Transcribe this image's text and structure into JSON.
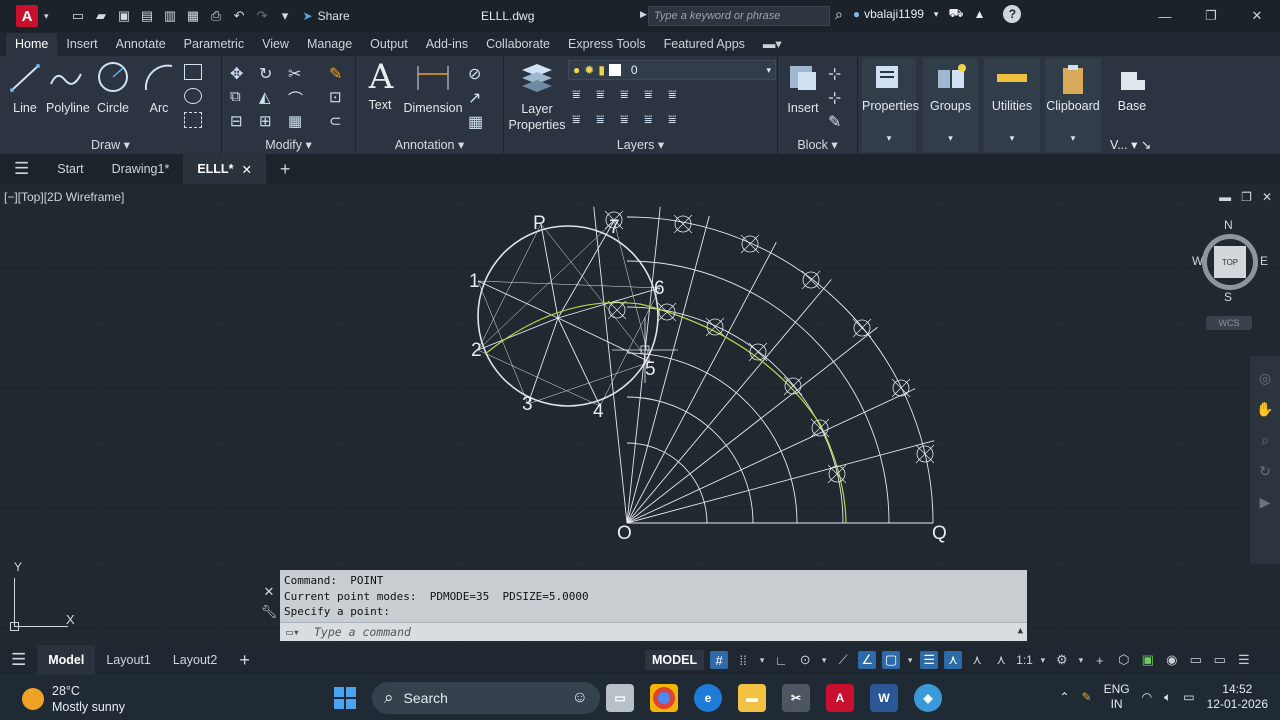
{
  "titlebar": {
    "share_label": "Share",
    "doc_title": "ELLL.dwg",
    "search_placeholder": "Type a keyword or phrase",
    "username": "vbalaji1199"
  },
  "ribbon_tabs": [
    "Home",
    "Insert",
    "Annotate",
    "Parametric",
    "View",
    "Manage",
    "Output",
    "Add-ins",
    "Collaborate",
    "Express Tools",
    "Featured Apps"
  ],
  "ribbon": {
    "draw": {
      "title": "Draw",
      "line": "Line",
      "polyline": "Polyline",
      "circle": "Circle",
      "arc": "Arc"
    },
    "modify": {
      "title": "Modify"
    },
    "annotation": {
      "title": "Annotation",
      "text": "Text",
      "dimension": "Dimension"
    },
    "layers": {
      "title": "Layers",
      "layer_properties_1": "Layer",
      "layer_properties_2": "Properties",
      "current_layer": "0"
    },
    "block": {
      "title": "Block",
      "insert": "Insert"
    },
    "properties": "Properties",
    "groups": "Groups",
    "utilities": "Utilities",
    "clipboard": "Clipboard",
    "base": "Base",
    "view_short": "V..."
  },
  "file_tabs": {
    "start": "Start",
    "drawing1": "Drawing1*",
    "active": "ELLL*"
  },
  "viewport": {
    "label": "[−][Top][2D Wireframe]",
    "viewcube": {
      "north": "N",
      "south": "S",
      "east": "E",
      "west": "W",
      "top": "TOP",
      "wcs": "WCS"
    },
    "ucs": {
      "y": "Y",
      "x": "X"
    },
    "drawing_labels": {
      "P": "P",
      "O": "O",
      "Q": "Q",
      "n1": "1",
      "n2": "2",
      "n3": "3",
      "n4": "4",
      "n5": "5",
      "n6": "6",
      "n7": "7"
    }
  },
  "command": {
    "line1": "Command:  POINT",
    "line2": "Current point modes:  PDMODE=35  PDSIZE=5.0000",
    "line3": "Specify a point:",
    "placeholder": "Type a command"
  },
  "statusbar": {
    "tabs": [
      "Model",
      "Layout1",
      "Layout2"
    ],
    "model_button": "MODEL",
    "scale": "1:1"
  },
  "taskbar": {
    "temperature": "28°C",
    "weather": "Mostly sunny",
    "search": "Search",
    "lang1": "ENG",
    "lang2": "IN",
    "time": "14:52",
    "date": "12-01-2026"
  },
  "colors": {
    "accent": "#2f6aa8",
    "autocad_red": "#c8102e",
    "curve": "#b8d446"
  }
}
